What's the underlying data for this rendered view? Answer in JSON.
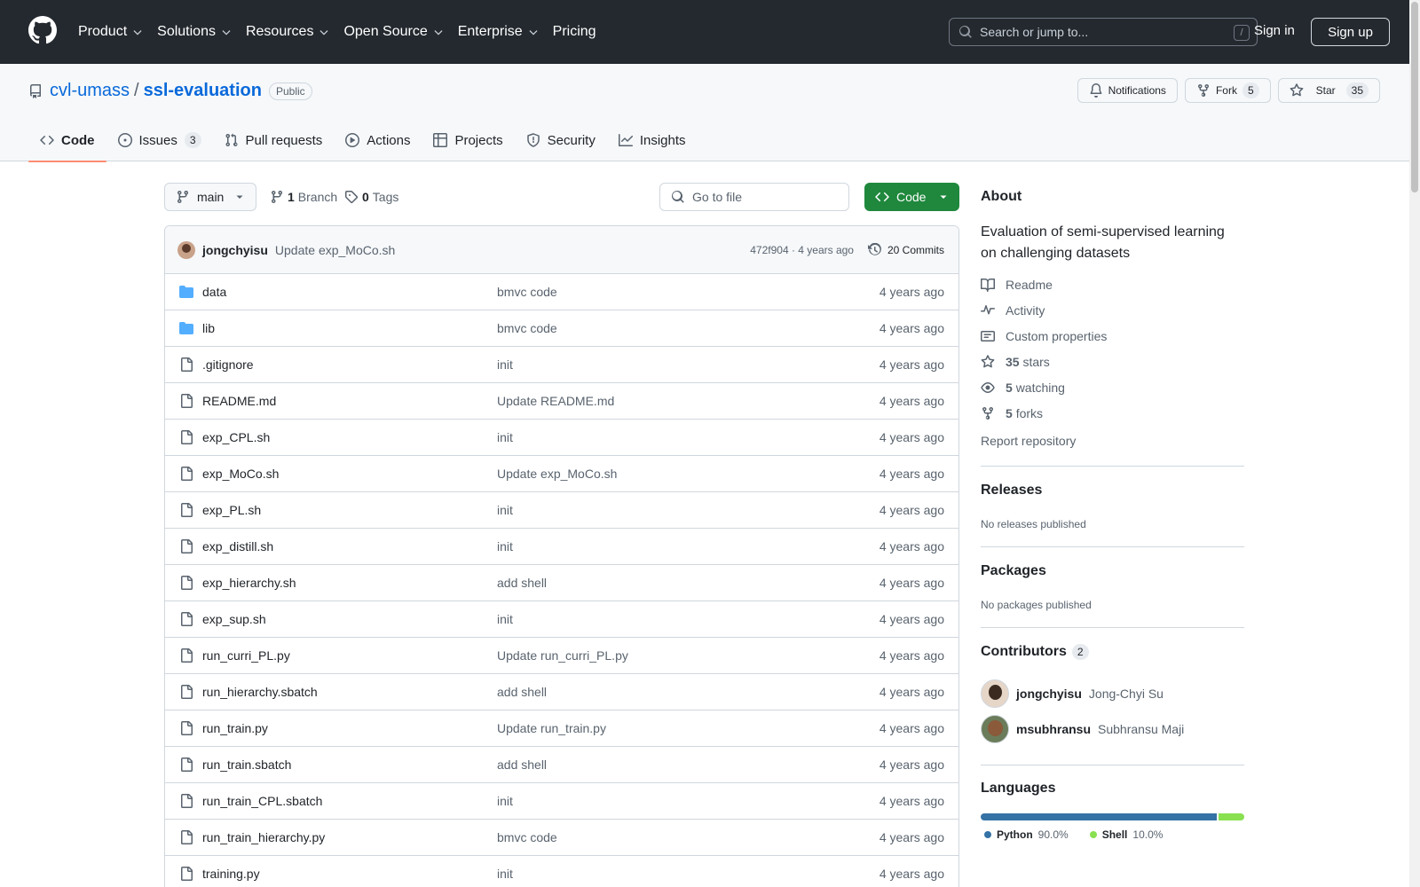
{
  "header": {
    "nav": [
      "Product",
      "Solutions",
      "Resources",
      "Open Source",
      "Enterprise",
      "Pricing"
    ],
    "search_placeholder": "Search or jump to...",
    "search_shortcut": "/",
    "sign_in": "Sign in",
    "sign_up": "Sign up"
  },
  "repo": {
    "owner": "cvl-umass",
    "separator": "/",
    "name": "ssl-evaluation",
    "visibility": "Public",
    "notifications_label": "Notifications",
    "fork_label": "Fork",
    "fork_count": "5",
    "star_label": "Star",
    "star_count": "35"
  },
  "tabs": [
    {
      "label": "Code",
      "count": ""
    },
    {
      "label": "Issues",
      "count": "3"
    },
    {
      "label": "Pull requests",
      "count": ""
    },
    {
      "label": "Actions",
      "count": ""
    },
    {
      "label": "Projects",
      "count": ""
    },
    {
      "label": "Security",
      "count": ""
    },
    {
      "label": "Insights",
      "count": ""
    }
  ],
  "toolbar": {
    "branch": "main",
    "branch_count": "1",
    "branch_label": "Branch",
    "tag_count": "0",
    "tag_label": "Tags",
    "goto_placeholder": "Go to file",
    "code_label": "Code"
  },
  "latest_commit": {
    "author": "jongchyisu",
    "message": "Update exp_MoCo.sh",
    "meta": "472f904 · 4 years ago",
    "commits": "20 Commits"
  },
  "files": [
    {
      "name": "data",
      "type": "dir",
      "message": "bmvc code",
      "age": "4 years ago"
    },
    {
      "name": "lib",
      "type": "dir",
      "message": "bmvc code",
      "age": "4 years ago"
    },
    {
      "name": ".gitignore",
      "type": "file",
      "message": "init",
      "age": "4 years ago"
    },
    {
      "name": "README.md",
      "type": "file",
      "message": "Update README.md",
      "age": "4 years ago"
    },
    {
      "name": "exp_CPL.sh",
      "type": "file",
      "message": "init",
      "age": "4 years ago"
    },
    {
      "name": "exp_MoCo.sh",
      "type": "file",
      "message": "Update exp_MoCo.sh",
      "age": "4 years ago"
    },
    {
      "name": "exp_PL.sh",
      "type": "file",
      "message": "init",
      "age": "4 years ago"
    },
    {
      "name": "exp_distill.sh",
      "type": "file",
      "message": "init",
      "age": "4 years ago"
    },
    {
      "name": "exp_hierarchy.sh",
      "type": "file",
      "message": "add shell",
      "age": "4 years ago"
    },
    {
      "name": "exp_sup.sh",
      "type": "file",
      "message": "init",
      "age": "4 years ago"
    },
    {
      "name": "run_curri_PL.py",
      "type": "file",
      "message": "Update run_curri_PL.py",
      "age": "4 years ago"
    },
    {
      "name": "run_hierarchy.sbatch",
      "type": "file",
      "message": "add shell",
      "age": "4 years ago"
    },
    {
      "name": "run_train.py",
      "type": "file",
      "message": "Update run_train.py",
      "age": "4 years ago"
    },
    {
      "name": "run_train.sbatch",
      "type": "file",
      "message": "add shell",
      "age": "4 years ago"
    },
    {
      "name": "run_train_CPL.sbatch",
      "type": "file",
      "message": "init",
      "age": "4 years ago"
    },
    {
      "name": "run_train_hierarchy.py",
      "type": "file",
      "message": "bmvc code",
      "age": "4 years ago"
    },
    {
      "name": "training.py",
      "type": "file",
      "message": "init",
      "age": "4 years ago"
    }
  ],
  "about": {
    "title": "About",
    "description": "Evaluation of semi-supervised learning on challenging datasets",
    "readme": "Readme",
    "activity": "Activity",
    "custom_properties": "Custom properties",
    "stars_count": "35",
    "stars_label": "stars",
    "watching_count": "5",
    "watching_label": "watching",
    "forks_count": "5",
    "forks_label": "forks",
    "report": "Report repository"
  },
  "releases": {
    "title": "Releases",
    "empty": "No releases published"
  },
  "packages": {
    "title": "Packages",
    "empty": "No packages published"
  },
  "contributors": {
    "title": "Contributors",
    "count": "2",
    "list": [
      {
        "login": "jongchyisu",
        "name": "Jong-Chyi Su"
      },
      {
        "login": "msubhransu",
        "name": "Subhransu Maji"
      }
    ]
  },
  "languages": {
    "title": "Languages",
    "list": [
      {
        "name": "Python",
        "percent": "90.0%",
        "value": 90.0,
        "color": "#3572A5"
      },
      {
        "name": "Shell",
        "percent": "10.0%",
        "value": 10.0,
        "color": "#89e051"
      }
    ]
  }
}
